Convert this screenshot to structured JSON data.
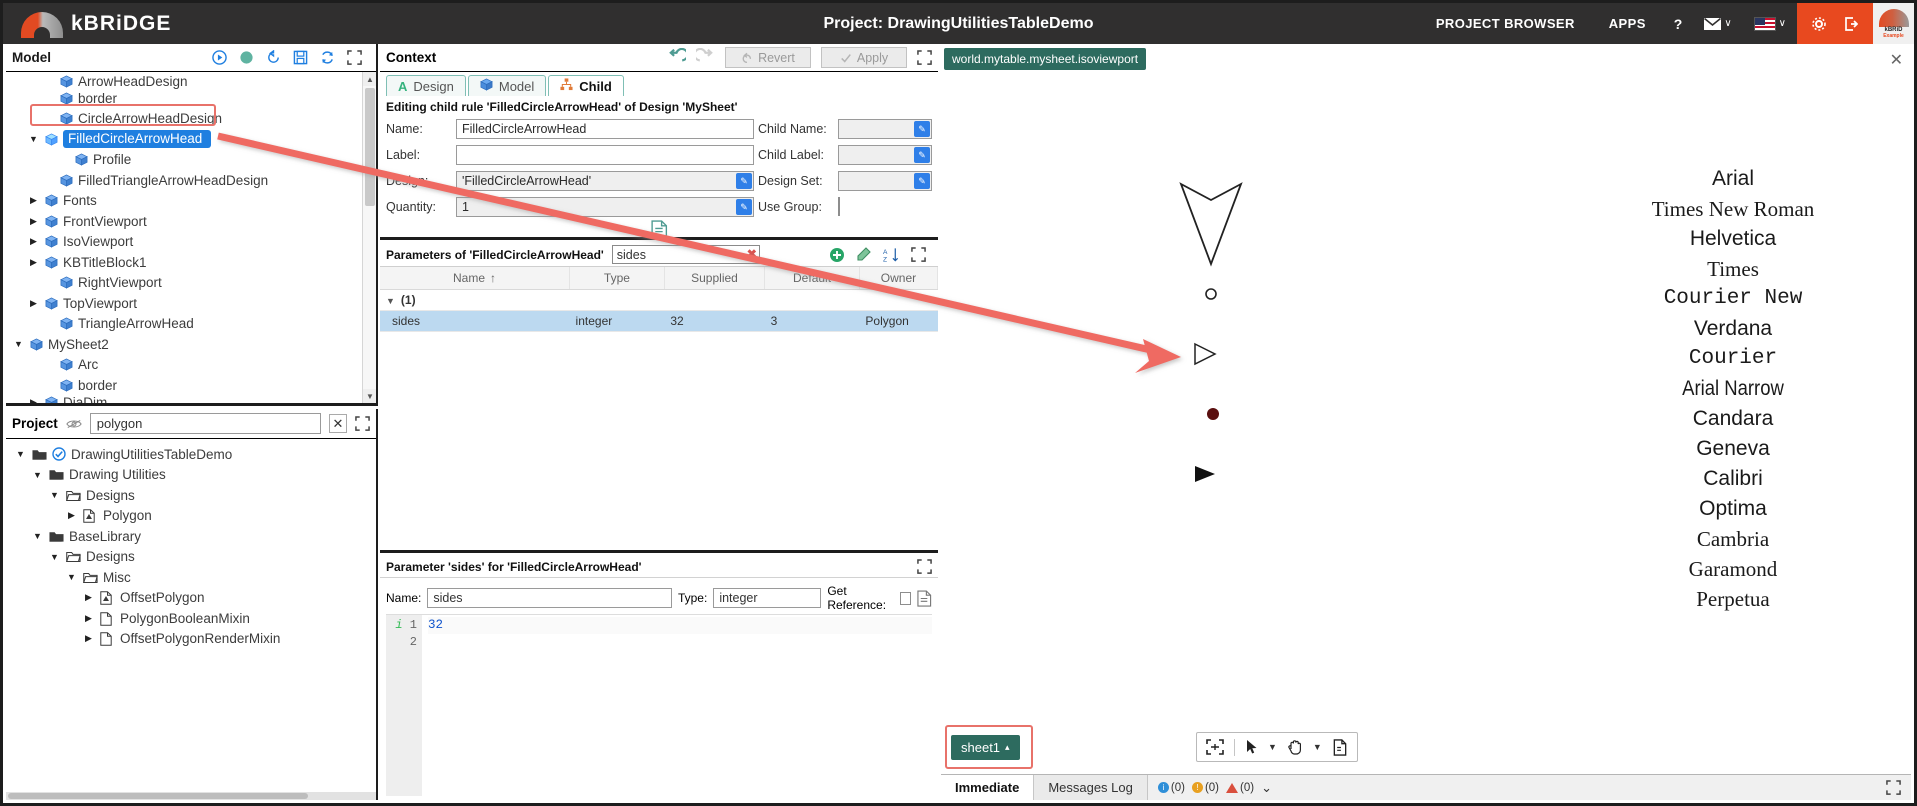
{
  "topbar": {
    "brand": "kBRiDGE",
    "project_title": "Project: DrawingUtilitiesTableDemo",
    "links": [
      {
        "label": "PROJECT BROWSER",
        "name": "project-browser-link"
      },
      {
        "label": "APPS",
        "name": "apps-link"
      }
    ],
    "help": "?",
    "mail_caret": "∨",
    "flag_caret": "∨",
    "avatar_line1": "kBRiD",
    "avatar_line2": "Example"
  },
  "model_panel": {
    "title": "Model",
    "icons": [
      "play-icon",
      "record-icon",
      "history-icon",
      "save-icon",
      "refresh-icon",
      "expand-icon"
    ],
    "tree": [
      {
        "label": "ArrowHeadDesign",
        "depth": 2,
        "twisty": "",
        "icon": "cube-icon",
        "clipped": true
      },
      {
        "label": "border",
        "depth": 2,
        "twisty": "",
        "icon": "cube-icon"
      },
      {
        "label": "CircleArrowHeadDesign",
        "depth": 2,
        "twisty": "",
        "icon": "cube-icon"
      },
      {
        "label": "FilledCircleArrowHead",
        "depth": 1,
        "twisty": "▼",
        "icon": "cube-icon",
        "selected": true
      },
      {
        "label": "Profile",
        "depth": 3,
        "twisty": "",
        "icon": "cube-icon"
      },
      {
        "label": "FilledTriangleArrowHeadDesign",
        "depth": 2,
        "twisty": "",
        "icon": "cube-icon"
      },
      {
        "label": "Fonts",
        "depth": 1,
        "twisty": "▶",
        "icon": "cube-icon"
      },
      {
        "label": "FrontViewport",
        "depth": 1,
        "twisty": "▶",
        "icon": "cube-icon"
      },
      {
        "label": "IsoViewport",
        "depth": 1,
        "twisty": "▶",
        "icon": "cube-icon"
      },
      {
        "label": "KBTitleBlock1",
        "depth": 1,
        "twisty": "▶",
        "icon": "cube-icon"
      },
      {
        "label": "RightViewport",
        "depth": 2,
        "twisty": "",
        "icon": "cube-icon"
      },
      {
        "label": "TopViewport",
        "depth": 1,
        "twisty": "▶",
        "icon": "cube-icon"
      },
      {
        "label": "TriangleArrowHead",
        "depth": 2,
        "twisty": "",
        "icon": "cube-icon"
      },
      {
        "label": "MySheet2",
        "depth": 0,
        "twisty": "▼",
        "icon": "cube-icon"
      },
      {
        "label": "Arc",
        "depth": 2,
        "twisty": "",
        "icon": "cube-icon"
      },
      {
        "label": "border",
        "depth": 2,
        "twisty": "",
        "icon": "cube-icon"
      },
      {
        "label": "DiaDim",
        "depth": 1,
        "twisty": "▶",
        "icon": "cube-icon",
        "clipped": true
      }
    ]
  },
  "project_panel": {
    "title": "Project",
    "search_value": "polygon",
    "search_placeholder": "",
    "clear_label": "✕",
    "icons": [
      "eye-slash-icon",
      "expand-icon"
    ],
    "tree": [
      {
        "label": "DrawingUtilitiesTableDemo",
        "depth": 0,
        "twisty": "▼",
        "icon": "folder-open-icon",
        "badge": "check-circle-icon"
      },
      {
        "label": "Drawing Utilities",
        "depth": 1,
        "twisty": "▼",
        "icon": "folder-open-icon"
      },
      {
        "label": "Designs",
        "depth": 2,
        "twisty": "▼",
        "icon": "folder-outline-icon"
      },
      {
        "label": "Polygon",
        "depth": 3,
        "twisty": "▶",
        "icon": "design-file-icon"
      },
      {
        "label": "BaseLibrary",
        "depth": 1,
        "twisty": "▼",
        "icon": "folder-open-icon"
      },
      {
        "label": "Designs",
        "depth": 2,
        "twisty": "▼",
        "icon": "folder-outline-icon"
      },
      {
        "label": "Misc",
        "depth": 3,
        "twisty": "▼",
        "icon": "folder-outline-icon"
      },
      {
        "label": "OffsetPolygon",
        "depth": 4,
        "twisty": "▶",
        "icon": "design-file-icon"
      },
      {
        "label": "PolygonBooleanMixin",
        "depth": 4,
        "twisty": "▶",
        "icon": "file-icon"
      },
      {
        "label": "OffsetPolygonRenderMixin",
        "depth": 4,
        "twisty": "▶",
        "icon": "file-icon"
      }
    ]
  },
  "context_panel": {
    "title": "Context",
    "undo_label": "undo-icon",
    "redo_label": "redo-icon",
    "revert_label": "Revert",
    "apply_label": "Apply",
    "expand_label": "expand-icon",
    "tabs": [
      {
        "label": "Design",
        "icon": "design-a-icon",
        "active": false
      },
      {
        "label": "Model",
        "icon": "cube-icon",
        "active": false
      },
      {
        "label": "Child",
        "icon": "hierarchy-icon",
        "active": true
      }
    ],
    "subtitle": "Editing child rule 'FilledCircleArrowHead' of Design 'MySheet'",
    "fields": {
      "name_label": "Name:",
      "name_value": "FilledCircleArrowHead",
      "label_label": "Label:",
      "label_value": "",
      "design_label": "Design:",
      "design_value": "'FilledCircleArrowHead'",
      "quantity_label": "Quantity:",
      "quantity_value": "1",
      "child_name_label": "Child Name:",
      "child_name_value": "",
      "child_label_label": "Child Label:",
      "child_label_value": "",
      "design_set_label": "Design Set:",
      "design_set_value": "",
      "use_group_label": "Use Group:",
      "use_group_checked": false
    }
  },
  "params_panel": {
    "title": "Parameters of 'FilledCircleArrowHead'",
    "search_value": "sides",
    "clear_label": "✖",
    "icons": [
      "add-icon",
      "clear-icon",
      "sort-az-icon",
      "expand-icon"
    ],
    "columns": [
      "Name",
      "Type",
      "Supplied",
      "Default",
      "Owner"
    ],
    "sort_indicator": "↑",
    "group_row": "(1)",
    "rows": [
      {
        "name": "sides",
        "type": "integer",
        "supplied": "32",
        "default": "3",
        "owner": "Polygon",
        "selected": true
      }
    ]
  },
  "param_editor": {
    "title": "Parameter 'sides' for 'FilledCircleArrowHead'",
    "name_label": "Name:",
    "name_value": "sides",
    "type_label": "Type:",
    "type_value": "integer",
    "get_reference_label": "Get Reference:",
    "get_reference_checked": false,
    "doc_icon": "document-icon",
    "code_lines": [
      {
        "n": "1",
        "text": "32"
      },
      {
        "n": "2",
        "text": ""
      }
    ],
    "info_marker": "i"
  },
  "viewport": {
    "path_tag": "world.mytable.mysheet.isoviewport",
    "close_label": "✕",
    "sheet_tab": "sheet1",
    "sheet_tab_caret": "▴",
    "toolbar_icons": [
      "fit-icon",
      "separator",
      "select-arrow-icon",
      "caret-down-icon",
      "pan-hand-icon",
      "caret-down-icon-2",
      "print-icon"
    ],
    "fonts": [
      "Arial",
      "Times New Roman",
      "Helvetica",
      "Times",
      "Courier New",
      "Verdana",
      "Courier",
      "Arial Narrow",
      "Candara",
      "Geneva",
      "Calibri",
      "Optima",
      "Cambria",
      "Garamond",
      "Perpetua"
    ]
  },
  "statusbar": {
    "immediate_tab": "Immediate",
    "messages_tab": "Messages Log",
    "badge_info": "(0)",
    "badge_warn": "(0)",
    "badge_error": "(0)",
    "caret": "⌄",
    "expand_icon": "expand-icon"
  },
  "colors": {
    "brand_orange": "#e8491f",
    "topbar_dark": "#302f2f",
    "selection_blue": "#1f7fe0",
    "annotation_red": "#e8726a",
    "teal": "#2d6b5f"
  }
}
